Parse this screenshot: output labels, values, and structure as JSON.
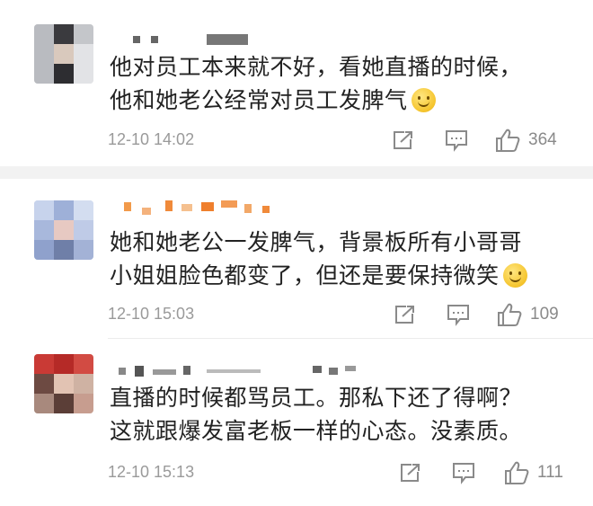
{
  "comments": [
    {
      "username": "",
      "text": "他对员工本来就不好，看她直播的时候，\n他和她老公经常对员工发脾气",
      "emoji": "smile-emoji",
      "time": "12-10 14:02",
      "likes": "364"
    },
    {
      "username": "",
      "text": "她和她老公一发脾气，背景板所有小哥哥\n小姐姐脸色都变了，但还是要保持微笑",
      "emoji": "smile-emoji",
      "time": "12-10 15:03",
      "likes": "109"
    },
    {
      "username": "",
      "text": "直播的时候都骂员工。那私下还了得啊？\n这就跟爆发富老板一样的心态。没素质。",
      "emoji": "",
      "time": "12-10 15:13",
      "likes": "111"
    }
  ],
  "icons": {
    "share": "share-icon",
    "comment": "comment-icon",
    "like": "thumbs-up-icon"
  },
  "colors": {
    "meta_gray": "#9a9a9a",
    "text": "#222222",
    "divider": "#f2f2f2",
    "emoji": "#f5c42c"
  }
}
